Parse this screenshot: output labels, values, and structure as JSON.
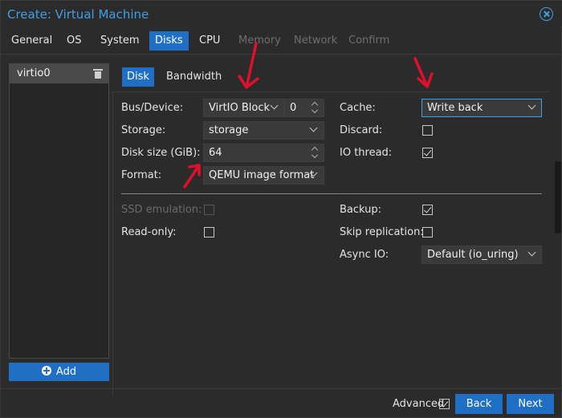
{
  "window": {
    "title": "Create: Virtual Machine"
  },
  "tabs": [
    {
      "label": "General",
      "state": "normal"
    },
    {
      "label": "OS",
      "state": "normal"
    },
    {
      "label": "System",
      "state": "normal"
    },
    {
      "label": "Disks",
      "state": "active"
    },
    {
      "label": "CPU",
      "state": "normal"
    },
    {
      "label": "Memory",
      "state": "disabled"
    },
    {
      "label": "Network",
      "state": "disabled"
    },
    {
      "label": "Confirm",
      "state": "disabled"
    }
  ],
  "disk_list": {
    "items": [
      {
        "label": "virtio0"
      }
    ],
    "add_label": "Add"
  },
  "inner_tabs": [
    {
      "label": "Disk",
      "active": true
    },
    {
      "label": "Bandwidth",
      "active": false
    }
  ],
  "form": {
    "bus_device": {
      "label": "Bus/Device:",
      "bus": "VirtIO Block",
      "device": "0"
    },
    "storage": {
      "label": "Storage:",
      "value": "storage"
    },
    "disk_size": {
      "label": "Disk size (GiB):",
      "value": "64"
    },
    "format": {
      "label": "Format:",
      "value": "QEMU image format"
    },
    "cache": {
      "label": "Cache:",
      "value": "Write back"
    },
    "discard": {
      "label": "Discard:",
      "checked": false
    },
    "io_thread": {
      "label": "IO thread:",
      "checked": true
    },
    "ssd_emulation": {
      "label": "SSD emulation:",
      "checked": false,
      "disabled": true
    },
    "read_only": {
      "label": "Read-only:",
      "checked": false
    },
    "backup": {
      "label": "Backup:",
      "checked": true
    },
    "skip_replication": {
      "label": "Skip replication:",
      "checked": false
    },
    "async_io": {
      "label": "Async IO:",
      "value": "Default (io_uring)"
    }
  },
  "footer": {
    "advanced_label": "Advanced",
    "advanced_checked": true,
    "back_label": "Back",
    "next_label": "Next"
  },
  "colors": {
    "accent": "#1f6fc5",
    "title": "#3ea0e6",
    "annotation_arrow": "#e0102a"
  }
}
